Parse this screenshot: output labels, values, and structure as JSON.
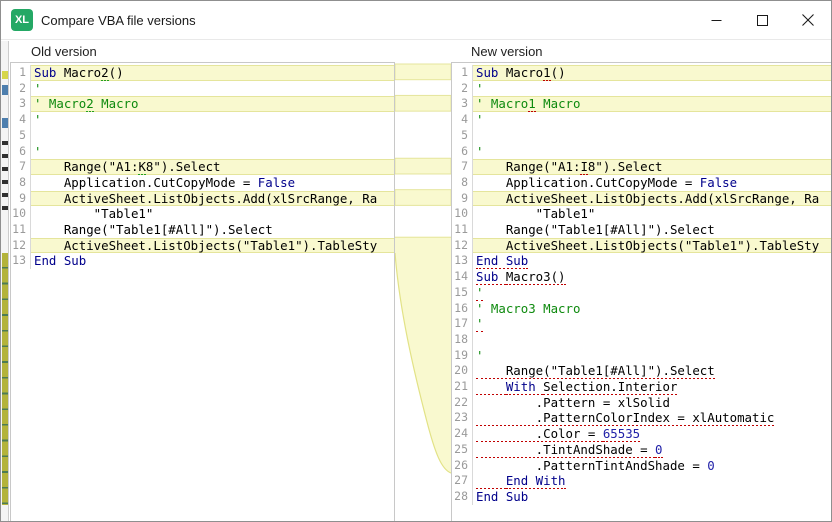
{
  "window": {
    "title": "Compare VBA file versions",
    "icon_text": "XL",
    "controls": {
      "minimize": "minimize",
      "maximize": "maximize",
      "close": "close"
    }
  },
  "colors": {
    "app_icon_green": "#24a865",
    "diff_highlight": "#f9f9cf",
    "diff_highlight_border": "#e5e59c",
    "keyword_blue": "#00008b",
    "comment_green": "#0e8a0e",
    "number_blue": "#2020a8",
    "old_change_marker_green": "#21a121",
    "new_change_marker_red": "#c00000",
    "ruler_olive": "#b3b33b"
  },
  "diff": {
    "changed_rows": [
      1,
      3,
      7,
      9,
      12
    ],
    "inserted_rows_new": [
      13,
      27
    ]
  },
  "panes": {
    "old": {
      "header": "Old version",
      "lines": [
        {
          "n": 1,
          "hl": true,
          "seg": [
            {
              "t": "Sub ",
              "c": "kw"
            },
            {
              "t": "Macro"
            },
            {
              "t": "2",
              "u": "g"
            },
            {
              "t": "()"
            }
          ]
        },
        {
          "n": 2,
          "seg": [
            {
              "t": "'",
              "c": "cm"
            }
          ]
        },
        {
          "n": 3,
          "hl": true,
          "seg": [
            {
              "t": "' Macro",
              "c": "cm"
            },
            {
              "t": "2",
              "c": "cm",
              "u": "g"
            },
            {
              "t": " Macro",
              "c": "cm"
            }
          ]
        },
        {
          "n": 4,
          "seg": [
            {
              "t": "'",
              "c": "cm"
            }
          ]
        },
        {
          "n": 5,
          "seg": []
        },
        {
          "n": 6,
          "seg": [
            {
              "t": "'",
              "c": "cm"
            }
          ]
        },
        {
          "n": 7,
          "hl": true,
          "seg": [
            {
              "t": "    Range(\"A1:"
            },
            {
              "t": "K",
              "u": "g"
            },
            {
              "t": "8\").Select"
            }
          ]
        },
        {
          "n": 8,
          "seg": [
            {
              "t": "    Application.CutCopyMode = "
            },
            {
              "t": "False",
              "c": "kw"
            }
          ]
        },
        {
          "n": 9,
          "hl": true,
          "seg": [
            {
              "t": "    ActiveSheet.ListObjects.Add(xlSrcRange, Ra"
            }
          ]
        },
        {
          "n": 10,
          "seg": [
            {
              "t": "        \"Table1\""
            }
          ]
        },
        {
          "n": 11,
          "seg": [
            {
              "t": "    Range(\"Table1[#All]\").Select"
            }
          ]
        },
        {
          "n": 12,
          "hl": true,
          "seg": [
            {
              "t": "    ActiveSheet.ListObjects(\"Table1\").TableSty"
            }
          ]
        },
        {
          "n": 13,
          "seg": [
            {
              "t": "End Sub",
              "c": "kw"
            }
          ]
        }
      ]
    },
    "new": {
      "header": "New version",
      "lines": [
        {
          "n": 1,
          "hl": true,
          "seg": [
            {
              "t": "Sub ",
              "c": "kw"
            },
            {
              "t": "Macro"
            },
            {
              "t": "1",
              "u": "r"
            },
            {
              "t": "()"
            }
          ]
        },
        {
          "n": 2,
          "seg": [
            {
              "t": "'",
              "c": "cm"
            }
          ]
        },
        {
          "n": 3,
          "hl": true,
          "seg": [
            {
              "t": "' Macro",
              "c": "cm"
            },
            {
              "t": "1",
              "c": "cm",
              "u": "r"
            },
            {
              "t": " Macro",
              "c": "cm"
            }
          ]
        },
        {
          "n": 4,
          "seg": [
            {
              "t": "'",
              "c": "cm"
            }
          ]
        },
        {
          "n": 5,
          "seg": []
        },
        {
          "n": 6,
          "seg": [
            {
              "t": "'",
              "c": "cm"
            }
          ]
        },
        {
          "n": 7,
          "hl": true,
          "seg": [
            {
              "t": "    Range(\"A1:"
            },
            {
              "t": "I",
              "u": "r"
            },
            {
              "t": "8\").Select"
            }
          ]
        },
        {
          "n": 8,
          "seg": [
            {
              "t": "    Application.CutCopyMode = "
            },
            {
              "t": "False",
              "c": "kw"
            }
          ]
        },
        {
          "n": 9,
          "hl": true,
          "seg": [
            {
              "t": "    ActiveSheet.ListObjects.Add(xlSrcRange, Ra"
            }
          ]
        },
        {
          "n": 10,
          "seg": [
            {
              "t": "        \"Table1\""
            }
          ]
        },
        {
          "n": 11,
          "seg": [
            {
              "t": "    Range(\"Table1[#All]\").Select"
            }
          ]
        },
        {
          "n": 12,
          "hl": true,
          "seg": [
            {
              "t": "    ActiveSheet.ListObjects(\"Table1\").TableSty"
            }
          ]
        },
        {
          "n": 13,
          "seg": [
            {
              "t": "End Sub",
              "c": "kw",
              "u": "r"
            }
          ]
        },
        {
          "n": 14,
          "seg": [
            {
              "t": "Sub ",
              "c": "kw",
              "u": "r"
            },
            {
              "t": "Macro3()",
              "u": "r"
            }
          ]
        },
        {
          "n": 15,
          "seg": [
            {
              "t": "'",
              "c": "cm",
              "u": "r"
            }
          ]
        },
        {
          "n": 16,
          "seg": [
            {
              "t": "' Macro3 Macro",
              "c": "cm",
              "u": "r"
            }
          ]
        },
        {
          "n": 17,
          "seg": [
            {
              "t": "'",
              "c": "cm",
              "u": "r"
            }
          ]
        },
        {
          "n": 18,
          "seg": []
        },
        {
          "n": 19,
          "seg": [
            {
              "t": "'",
              "c": "cm",
              "u": "r"
            }
          ]
        },
        {
          "n": 20,
          "seg": [
            {
              "t": "    Range(\"Table1[#All]\").Select",
              "u": "r"
            }
          ]
        },
        {
          "n": 21,
          "seg": [
            {
              "t": "    ",
              "u": "r"
            },
            {
              "t": "With ",
              "c": "kw",
              "u": "r"
            },
            {
              "t": "Selection.Interior",
              "u": "r"
            }
          ]
        },
        {
          "n": 22,
          "seg": [
            {
              "t": "        .Pattern = xlSolid",
              "u": "r"
            }
          ]
        },
        {
          "n": 23,
          "seg": [
            {
              "t": "        .PatternColorIndex = xlAutomatic",
              "u": "r"
            }
          ]
        },
        {
          "n": 24,
          "seg": [
            {
              "t": "        .Color = ",
              "u": "r"
            },
            {
              "t": "65535",
              "c": "num",
              "u": "r"
            }
          ]
        },
        {
          "n": 25,
          "seg": [
            {
              "t": "        .TintAndShade = ",
              "u": "r"
            },
            {
              "t": "0",
              "c": "num",
              "u": "r"
            }
          ]
        },
        {
          "n": 26,
          "seg": [
            {
              "t": "        .PatternTintAndShade = ",
              "u": "r"
            },
            {
              "t": "0",
              "c": "num",
              "u": "r"
            }
          ]
        },
        {
          "n": 27,
          "seg": [
            {
              "t": "    ",
              "u": "r"
            },
            {
              "t": "End With",
              "c": "kw",
              "u": "r"
            }
          ]
        },
        {
          "n": 28,
          "seg": [
            {
              "t": "End Sub",
              "c": "kw"
            }
          ]
        }
      ]
    }
  }
}
